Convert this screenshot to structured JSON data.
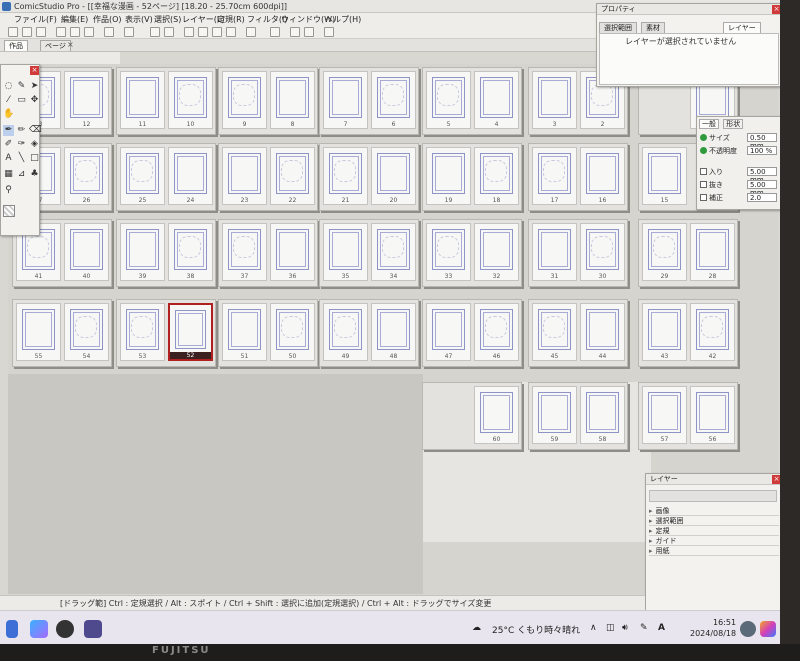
{
  "window": {
    "title": "ComicStudio Pro - [[幸福な漫画 - 52ページ] [18.20 - 25.70cm 600dpi]]"
  },
  "menu": [
    "ファイル(F)",
    "編集(E)",
    "作品(O)",
    "表示(V)",
    "選択(S)",
    "レイヤー(L)",
    "定規(R)",
    "フィルタ(I)",
    "ウィンドウ(W)",
    "ヘルプ(H)"
  ],
  "tabs": [
    {
      "label": "作品"
    },
    {
      "label": "ページ"
    }
  ],
  "pages": {
    "selected": "52",
    "rows": [
      [
        [
          "13",
          "12"
        ],
        [
          "11",
          "10"
        ],
        [
          "9",
          "8"
        ],
        [
          "7",
          "6"
        ],
        [
          "5",
          "4"
        ],
        [
          "3",
          "2"
        ],
        [
          "",
          "1"
        ]
      ],
      [
        [
          "27",
          "26"
        ],
        [
          "25",
          "24"
        ],
        [
          "23",
          "22"
        ],
        [
          "21",
          "20"
        ],
        [
          "19",
          "18"
        ],
        [
          "17",
          "16"
        ],
        [
          "15",
          ""
        ]
      ],
      [
        [
          "41",
          "40"
        ],
        [
          "39",
          "38"
        ],
        [
          "37",
          "36"
        ],
        [
          "35",
          "34"
        ],
        [
          "33",
          "32"
        ],
        [
          "31",
          "30"
        ],
        [
          "29",
          "28"
        ]
      ],
      [
        [
          "55",
          "54"
        ],
        [
          "53",
          "52"
        ],
        [
          "51",
          "50"
        ],
        [
          "49",
          "48"
        ],
        [
          "47",
          "46"
        ],
        [
          "45",
          "44"
        ],
        [
          "43",
          "42"
        ]
      ],
      [
        [
          "",
          "60"
        ],
        [
          "59",
          "58"
        ],
        [
          "57",
          "56"
        ]
      ]
    ]
  },
  "properties_panel": {
    "title": "プロパティ",
    "tabs": [
      "選択範囲",
      "素材",
      "レイヤー"
    ],
    "message": "レイヤーが選択されていません"
  },
  "pen_panel": {
    "tabs": [
      "一般",
      "形状"
    ],
    "rows": [
      {
        "label": "サイズ",
        "value": "0.50 mm",
        "kind": "dot"
      },
      {
        "label": "不透明度",
        "value": "100 %",
        "kind": "dot"
      },
      {
        "label": "入り",
        "value": "5.00 mm",
        "kind": "box"
      },
      {
        "label": "抜き",
        "value": "5.00 mm",
        "kind": "box"
      },
      {
        "label": "補正",
        "value": "2.0",
        "kind": "box"
      }
    ]
  },
  "layer_panel": {
    "title": "レイヤー",
    "items": [
      "画像",
      "選択範囲",
      "定規",
      "ガイド",
      "用紙"
    ]
  },
  "statusbar": {
    "text": "[ドラッグ範] Ctrl : 定規選択 / Alt : スポイト / Ctrl + Shift : 選択に追加(定規選択) / Ctrl + Alt : ドラッグでサイズ変更"
  },
  "taskbar": {
    "weather": "25°C くもり時々晴れ",
    "ime": "A",
    "time": "16:51",
    "date": "2024/08/18"
  },
  "monitor": {
    "brand": "FUJITSU"
  }
}
